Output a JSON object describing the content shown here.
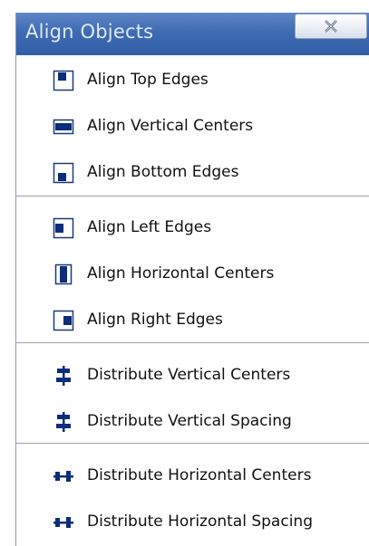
{
  "window": {
    "title": "Align Objects",
    "close_icon": "close-icon"
  },
  "groups": [
    {
      "items": [
        {
          "label": "Align Top Edges",
          "icon": "align-top-icon"
        },
        {
          "label": "Align Vertical Centers",
          "icon": "align-vertical-centers-icon"
        },
        {
          "label": "Align Bottom Edges",
          "icon": "align-bottom-icon"
        }
      ]
    },
    {
      "items": [
        {
          "label": "Align Left Edges",
          "icon": "align-left-icon"
        },
        {
          "label": "Align Horizontal Centers",
          "icon": "align-horizontal-centers-icon"
        },
        {
          "label": "Align Right Edges",
          "icon": "align-right-icon"
        }
      ]
    },
    {
      "items": [
        {
          "label": "Distribute Vertical Centers",
          "icon": "distribute-vertical-centers-icon"
        },
        {
          "label": "Distribute Vertical Spacing",
          "icon": "distribute-vertical-spacing-icon"
        }
      ]
    },
    {
      "items": [
        {
          "label": "Distribute Horizontal Centers",
          "icon": "distribute-horizontal-centers-icon"
        },
        {
          "label": "Distribute Horizontal Spacing",
          "icon": "distribute-horizontal-spacing-icon"
        }
      ]
    }
  ],
  "colors": {
    "titlebar": "#3f6bb3",
    "icon_fill": "#0b2d7a",
    "icon_border": "#1b3a7a"
  }
}
